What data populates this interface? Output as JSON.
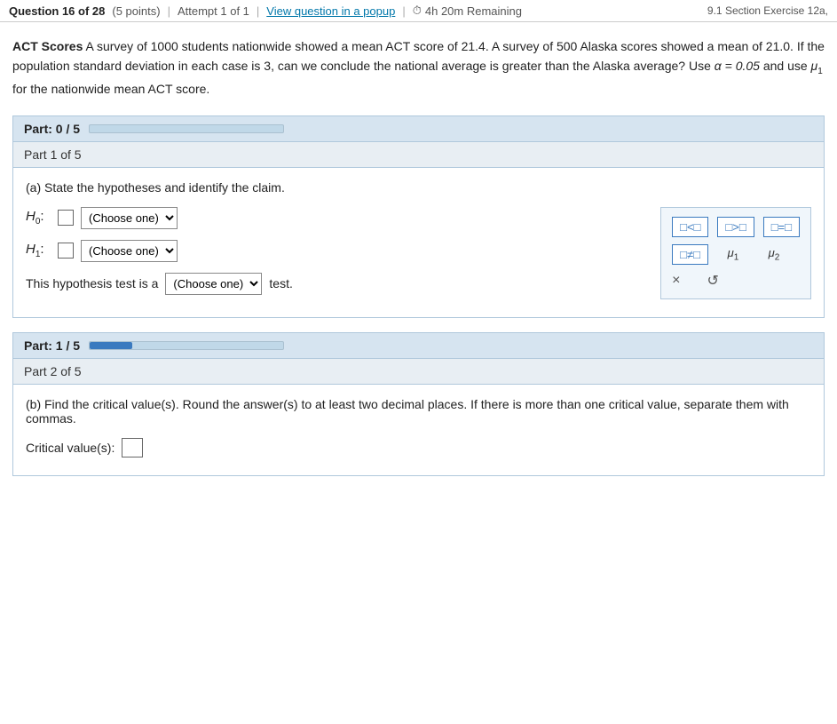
{
  "header": {
    "question_info": "Question 16 of 28",
    "points": "(5 points)",
    "attempt": "Attempt 1 of 1",
    "popup_link": "View question in a popup",
    "timer_icon": "⏱",
    "timer": "4h 20m Remaining",
    "section_ref": "9.1 Section Exercise 12a,"
  },
  "problem": {
    "title": "ACT Scores",
    "text": "A survey of 1000 students nationwide showed a mean ACT score of 21.4. A survey of 500 Alaska scores showed a mean of 21.0. If the population standard deviation in each case is 3, can we conclude the national average is greater than the Alaska average? Use α = 0.05 and use μ₁ for the nationwide mean ACT score."
  },
  "part0": {
    "label": "Part: 0 / 5",
    "fill_width": "0%"
  },
  "part1_subheader": "Part 1 of 5",
  "part1": {
    "instruction": "(a) State the hypotheses and identify the claim.",
    "h0_label": "H₀:",
    "h1_label": "H₁:",
    "choose_one": "Choose one",
    "test_prefix": "This hypothesis test is a",
    "test_suffix": "test.",
    "symbols": {
      "row1": [
        "□<□",
        "□>□",
        "□=□"
      ],
      "row2": [
        "□≠□",
        "μ₁",
        "μ₂"
      ],
      "close": "×",
      "reset": "↺"
    }
  },
  "part1_progress": {
    "label": "Part: 1 / 5",
    "fill_width": "22%"
  },
  "part2_subheader": "Part 2 of 5",
  "part2": {
    "instruction": "(b) Find the critical value(s). Round the answer(s) to at least two decimal places. If there is more than one critical value, separate them with commas.",
    "critical_label": "Critical value(s):"
  }
}
